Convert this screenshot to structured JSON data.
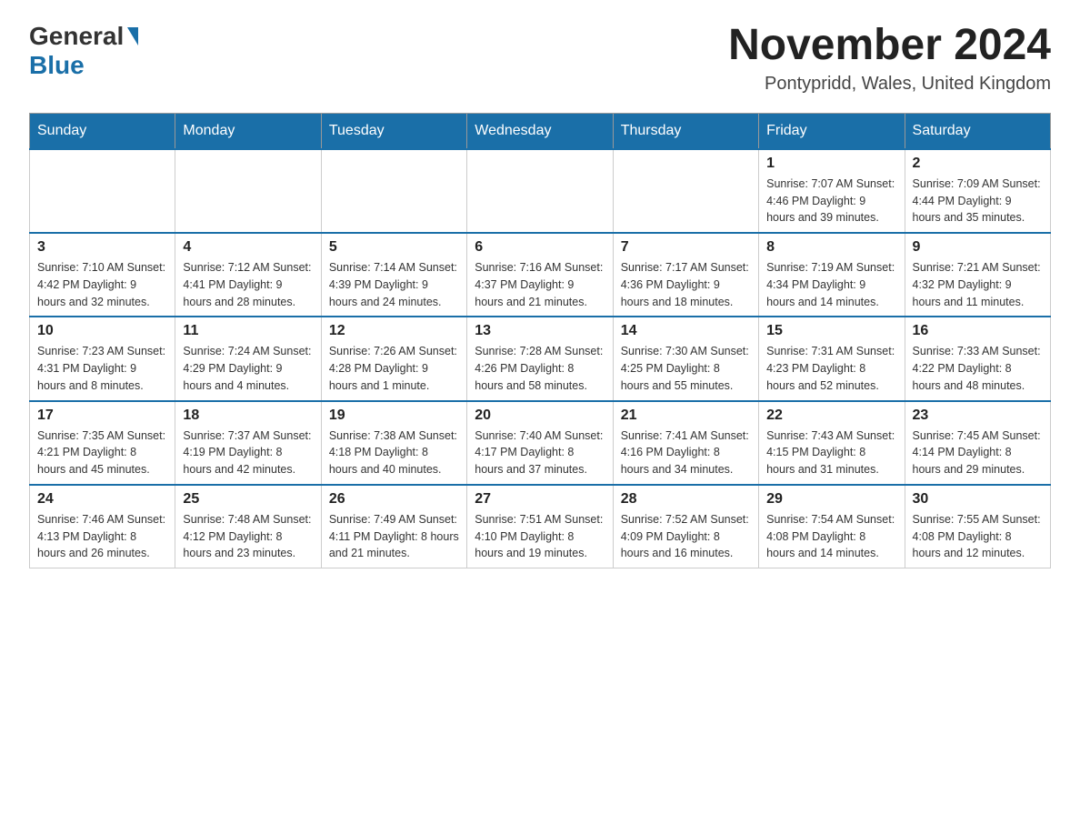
{
  "header": {
    "logo_general": "General",
    "logo_blue": "Blue",
    "month_title": "November 2024",
    "location": "Pontypridd, Wales, United Kingdom"
  },
  "days_of_week": [
    "Sunday",
    "Monday",
    "Tuesday",
    "Wednesday",
    "Thursday",
    "Friday",
    "Saturday"
  ],
  "weeks": [
    [
      {
        "day": "",
        "info": ""
      },
      {
        "day": "",
        "info": ""
      },
      {
        "day": "",
        "info": ""
      },
      {
        "day": "",
        "info": ""
      },
      {
        "day": "",
        "info": ""
      },
      {
        "day": "1",
        "info": "Sunrise: 7:07 AM\nSunset: 4:46 PM\nDaylight: 9 hours\nand 39 minutes."
      },
      {
        "day": "2",
        "info": "Sunrise: 7:09 AM\nSunset: 4:44 PM\nDaylight: 9 hours\nand 35 minutes."
      }
    ],
    [
      {
        "day": "3",
        "info": "Sunrise: 7:10 AM\nSunset: 4:42 PM\nDaylight: 9 hours\nand 32 minutes."
      },
      {
        "day": "4",
        "info": "Sunrise: 7:12 AM\nSunset: 4:41 PM\nDaylight: 9 hours\nand 28 minutes."
      },
      {
        "day": "5",
        "info": "Sunrise: 7:14 AM\nSunset: 4:39 PM\nDaylight: 9 hours\nand 24 minutes."
      },
      {
        "day": "6",
        "info": "Sunrise: 7:16 AM\nSunset: 4:37 PM\nDaylight: 9 hours\nand 21 minutes."
      },
      {
        "day": "7",
        "info": "Sunrise: 7:17 AM\nSunset: 4:36 PM\nDaylight: 9 hours\nand 18 minutes."
      },
      {
        "day": "8",
        "info": "Sunrise: 7:19 AM\nSunset: 4:34 PM\nDaylight: 9 hours\nand 14 minutes."
      },
      {
        "day": "9",
        "info": "Sunrise: 7:21 AM\nSunset: 4:32 PM\nDaylight: 9 hours\nand 11 minutes."
      }
    ],
    [
      {
        "day": "10",
        "info": "Sunrise: 7:23 AM\nSunset: 4:31 PM\nDaylight: 9 hours\nand 8 minutes."
      },
      {
        "day": "11",
        "info": "Sunrise: 7:24 AM\nSunset: 4:29 PM\nDaylight: 9 hours\nand 4 minutes."
      },
      {
        "day": "12",
        "info": "Sunrise: 7:26 AM\nSunset: 4:28 PM\nDaylight: 9 hours\nand 1 minute."
      },
      {
        "day": "13",
        "info": "Sunrise: 7:28 AM\nSunset: 4:26 PM\nDaylight: 8 hours\nand 58 minutes."
      },
      {
        "day": "14",
        "info": "Sunrise: 7:30 AM\nSunset: 4:25 PM\nDaylight: 8 hours\nand 55 minutes."
      },
      {
        "day": "15",
        "info": "Sunrise: 7:31 AM\nSunset: 4:23 PM\nDaylight: 8 hours\nand 52 minutes."
      },
      {
        "day": "16",
        "info": "Sunrise: 7:33 AM\nSunset: 4:22 PM\nDaylight: 8 hours\nand 48 minutes."
      }
    ],
    [
      {
        "day": "17",
        "info": "Sunrise: 7:35 AM\nSunset: 4:21 PM\nDaylight: 8 hours\nand 45 minutes."
      },
      {
        "day": "18",
        "info": "Sunrise: 7:37 AM\nSunset: 4:19 PM\nDaylight: 8 hours\nand 42 minutes."
      },
      {
        "day": "19",
        "info": "Sunrise: 7:38 AM\nSunset: 4:18 PM\nDaylight: 8 hours\nand 40 minutes."
      },
      {
        "day": "20",
        "info": "Sunrise: 7:40 AM\nSunset: 4:17 PM\nDaylight: 8 hours\nand 37 minutes."
      },
      {
        "day": "21",
        "info": "Sunrise: 7:41 AM\nSunset: 4:16 PM\nDaylight: 8 hours\nand 34 minutes."
      },
      {
        "day": "22",
        "info": "Sunrise: 7:43 AM\nSunset: 4:15 PM\nDaylight: 8 hours\nand 31 minutes."
      },
      {
        "day": "23",
        "info": "Sunrise: 7:45 AM\nSunset: 4:14 PM\nDaylight: 8 hours\nand 29 minutes."
      }
    ],
    [
      {
        "day": "24",
        "info": "Sunrise: 7:46 AM\nSunset: 4:13 PM\nDaylight: 8 hours\nand 26 minutes."
      },
      {
        "day": "25",
        "info": "Sunrise: 7:48 AM\nSunset: 4:12 PM\nDaylight: 8 hours\nand 23 minutes."
      },
      {
        "day": "26",
        "info": "Sunrise: 7:49 AM\nSunset: 4:11 PM\nDaylight: 8 hours\nand 21 minutes."
      },
      {
        "day": "27",
        "info": "Sunrise: 7:51 AM\nSunset: 4:10 PM\nDaylight: 8 hours\nand 19 minutes."
      },
      {
        "day": "28",
        "info": "Sunrise: 7:52 AM\nSunset: 4:09 PM\nDaylight: 8 hours\nand 16 minutes."
      },
      {
        "day": "29",
        "info": "Sunrise: 7:54 AM\nSunset: 4:08 PM\nDaylight: 8 hours\nand 14 minutes."
      },
      {
        "day": "30",
        "info": "Sunrise: 7:55 AM\nSunset: 4:08 PM\nDaylight: 8 hours\nand 12 minutes."
      }
    ]
  ]
}
